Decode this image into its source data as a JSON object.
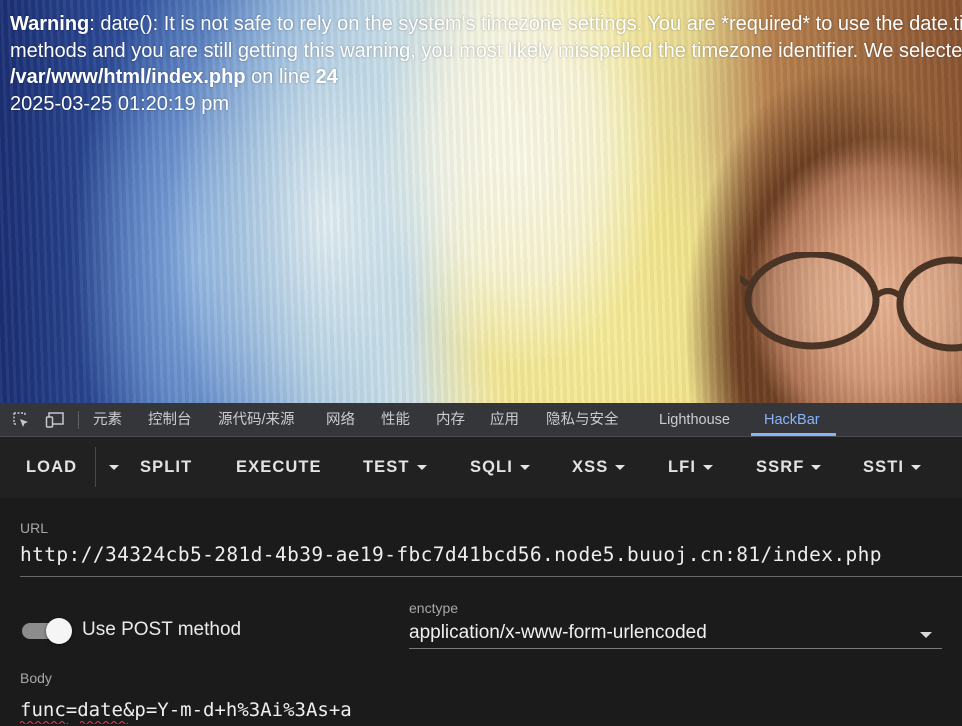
{
  "page": {
    "warning_label": "Warning",
    "warning_line1": ": date(): It is not safe to rely on the system's timezone settings. You are *required* to use the date.timezone setting or the date_default_timezone_set() function. In case you used any of those",
    "warning_line2": "methods and you are still getting this warning, you most likely misspelled the timezone identifier. We selected the timezone 'UTC' for now, but please set date.timezone to select your timezone. in",
    "file_path": "/var/www/html/index.php",
    "on_line_text": " on line ",
    "line_number": "24",
    "date_output": "2025-03-25 01:20:19 pm"
  },
  "devtools": {
    "tabs": [
      {
        "label": "元素"
      },
      {
        "label": "控制台"
      },
      {
        "label": "源代码/来源"
      },
      {
        "label": "网络"
      },
      {
        "label": "性能"
      },
      {
        "label": "内存"
      },
      {
        "label": "应用"
      },
      {
        "label": "隐私与安全"
      },
      {
        "label": "Lighthouse"
      },
      {
        "label": "HackBar"
      }
    ],
    "active_tab": "HackBar",
    "icons": [
      "inspect-element-icon",
      "device-toolbar-icon"
    ],
    "accent_color": "#8ab4f8"
  },
  "hackbar": {
    "toolbar": {
      "load": "LOAD",
      "split": "SPLIT",
      "execute": "EXECUTE",
      "test": "TEST",
      "sqli": "SQLI",
      "xss": "XSS",
      "lfi": "LFI",
      "ssrf": "SSRF",
      "ssti": "SSTI"
    },
    "url": {
      "label": "URL",
      "value": "http://34324cb5-281d-4b39-ae19-fbc7d41bcd56.node5.buuoj.cn:81/index.php"
    },
    "post": {
      "label": "Use POST method",
      "enabled": true
    },
    "enctype": {
      "label": "enctype",
      "value": "application/x-www-form-urlencoded"
    },
    "body": {
      "label": "Body",
      "value": "func=date&p=Y-m-d+h%3Ai%3As+a"
    }
  }
}
